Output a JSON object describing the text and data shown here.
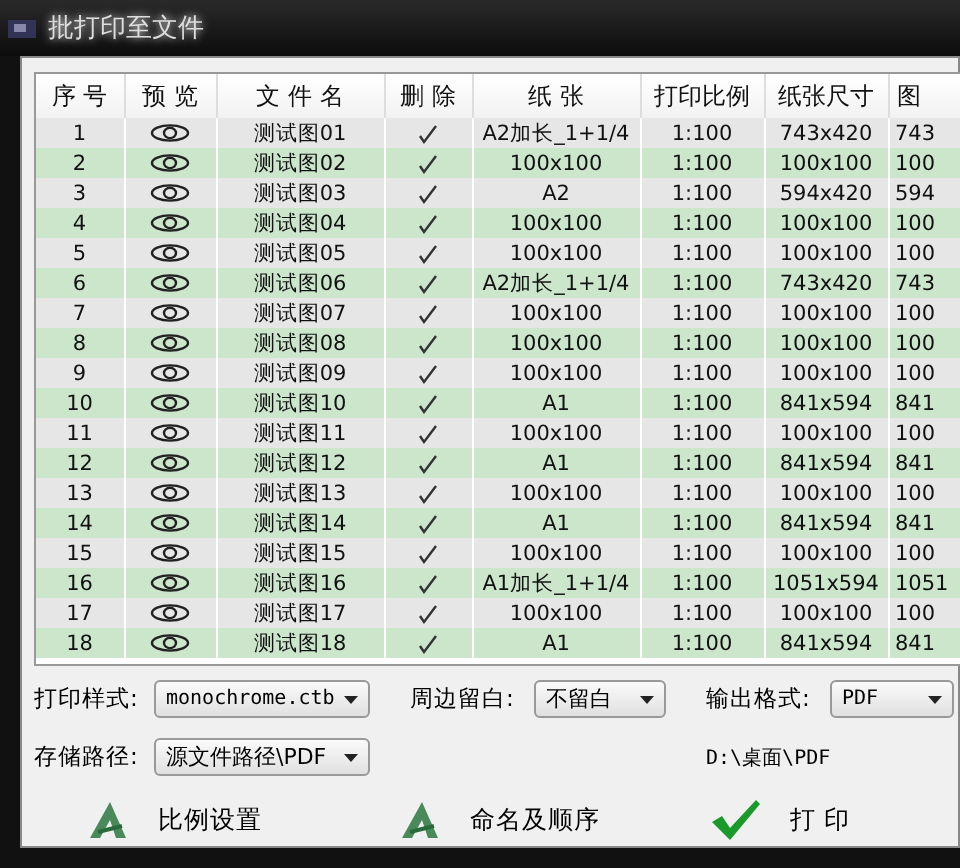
{
  "window": {
    "title": "批打印至文件"
  },
  "table": {
    "columns": [
      "序 号",
      "预 览",
      "文 件 名",
      "删 除",
      "纸 张",
      "打印比例",
      "纸张尺寸",
      "图"
    ],
    "rows": [
      {
        "no": "1",
        "name": "测试图01",
        "delete": true,
        "paper": "A2加长_1+1/4",
        "scale": "1:100",
        "size": "743x420",
        "column_8": "743"
      },
      {
        "no": "2",
        "name": "测试图02",
        "delete": true,
        "paper": "100x100",
        "scale": "1:100",
        "size": "100x100",
        "column_8": "100"
      },
      {
        "no": "3",
        "name": "测试图03",
        "delete": true,
        "paper": "A2",
        "scale": "1:100",
        "size": "594x420",
        "column_8": "594"
      },
      {
        "no": "4",
        "name": "测试图04",
        "delete": true,
        "paper": "100x100",
        "scale": "1:100",
        "size": "100x100",
        "column_8": "100"
      },
      {
        "no": "5",
        "name": "测试图05",
        "delete": true,
        "paper": "100x100",
        "scale": "1:100",
        "size": "100x100",
        "column_8": "100"
      },
      {
        "no": "6",
        "name": "测试图06",
        "delete": true,
        "paper": "A2加长_1+1/4",
        "scale": "1:100",
        "size": "743x420",
        "column_8": "743"
      },
      {
        "no": "7",
        "name": "测试图07",
        "delete": true,
        "paper": "100x100",
        "scale": "1:100",
        "size": "100x100",
        "column_8": "100"
      },
      {
        "no": "8",
        "name": "测试图08",
        "delete": true,
        "paper": "100x100",
        "scale": "1:100",
        "size": "100x100",
        "column_8": "100"
      },
      {
        "no": "9",
        "name": "测试图09",
        "delete": true,
        "paper": "100x100",
        "scale": "1:100",
        "size": "100x100",
        "column_8": "100"
      },
      {
        "no": "10",
        "name": "测试图10",
        "delete": true,
        "paper": "A1",
        "scale": "1:100",
        "size": "841x594",
        "column_8": "841"
      },
      {
        "no": "11",
        "name": "测试图11",
        "delete": true,
        "paper": "100x100",
        "scale": "1:100",
        "size": "100x100",
        "column_8": "100"
      },
      {
        "no": "12",
        "name": "测试图12",
        "delete": true,
        "paper": "A1",
        "scale": "1:100",
        "size": "841x594",
        "column_8": "841"
      },
      {
        "no": "13",
        "name": "测试图13",
        "delete": true,
        "paper": "100x100",
        "scale": "1:100",
        "size": "100x100",
        "column_8": "100"
      },
      {
        "no": "14",
        "name": "测试图14",
        "delete": true,
        "paper": "A1",
        "scale": "1:100",
        "size": "841x594",
        "column_8": "841"
      },
      {
        "no": "15",
        "name": "测试图15",
        "delete": true,
        "paper": "100x100",
        "scale": "1:100",
        "size": "100x100",
        "column_8": "100"
      },
      {
        "no": "16",
        "name": "测试图16",
        "delete": true,
        "paper": "A1加长_1+1/4",
        "scale": "1:100",
        "size": "1051x594",
        "column_8": "1051"
      },
      {
        "no": "17",
        "name": "测试图17",
        "delete": true,
        "paper": "100x100",
        "scale": "1:100",
        "size": "100x100",
        "column_8": "100"
      },
      {
        "no": "18",
        "name": "测试图18",
        "delete": true,
        "paper": "A1",
        "scale": "1:100",
        "size": "841x594",
        "column_8": "841"
      }
    ]
  },
  "options": {
    "print_style": {
      "label": "打印样式:",
      "value": "monochrome.ctb"
    },
    "margin": {
      "label": "周边留白:",
      "value": "不留白"
    },
    "output_format": {
      "label": "输出格式:",
      "value": "PDF"
    },
    "save_path": {
      "label": "存储路径:",
      "value": "源文件路径\\PDF"
    },
    "path_display": "D:\\桌面\\PDF"
  },
  "buttons": [
    {
      "kind": "scale",
      "label": "比例设置"
    },
    {
      "kind": "scale",
      "label": "命名及顺序"
    },
    {
      "kind": "print",
      "label": "打 印"
    }
  ]
}
